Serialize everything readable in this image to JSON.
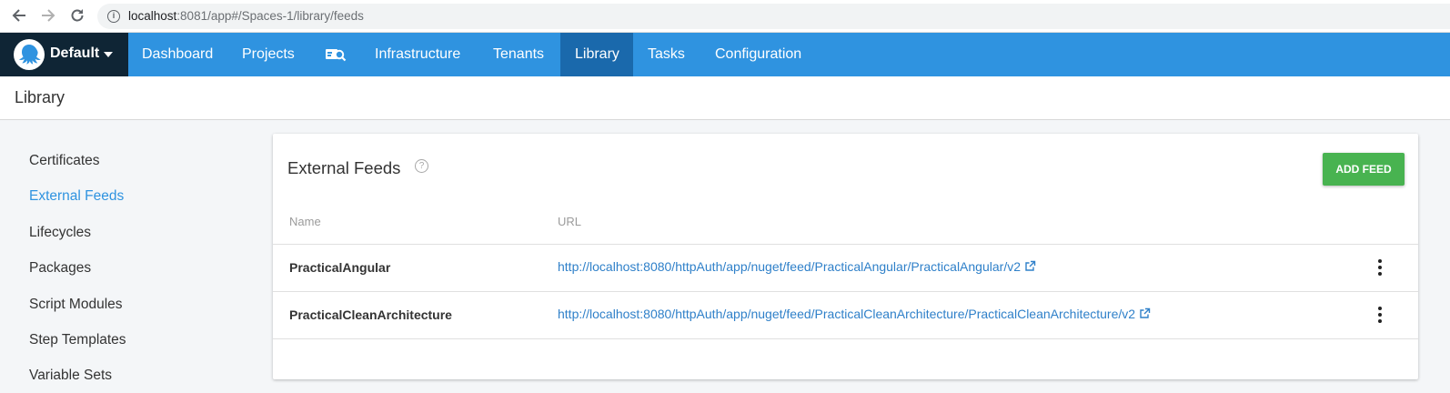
{
  "browser": {
    "url_host": "localhost",
    "url_rest": ":8081/app#/Spaces-1/library/feeds"
  },
  "topnav": {
    "space": "Default",
    "items": [
      "Dashboard",
      "Projects",
      "Infrastructure",
      "Tenants",
      "Library",
      "Tasks",
      "Configuration"
    ],
    "active": "Library"
  },
  "page": {
    "title": "Library"
  },
  "sidebar": {
    "items": [
      "Certificates",
      "External Feeds",
      "Lifecycles",
      "Packages",
      "Script Modules",
      "Step Templates",
      "Variable Sets"
    ],
    "active": "External Feeds"
  },
  "feeds": {
    "title": "External Feeds",
    "add_label": "ADD FEED",
    "columns": {
      "name": "Name",
      "url": "URL"
    },
    "rows": [
      {
        "name": "PracticalAngular",
        "url": "http://localhost:8080/httpAuth/app/nuget/feed/PracticalAngular/PracticalAngular/v2"
      },
      {
        "name": "PracticalCleanArchitecture",
        "url": "http://localhost:8080/httpAuth/app/nuget/feed/PracticalCleanArchitecture/PracticalCleanArchitecture/v2"
      }
    ]
  },
  "colors": {
    "nav_bg": "#2f93e0",
    "nav_active": "#1a69ac",
    "space_bg": "#0f2535",
    "link": "#2f80c9",
    "add_button": "#48b350"
  },
  "icons": [
    "back-arrow-icon",
    "forward-arrow-icon",
    "reload-icon",
    "info-icon",
    "octopus-logo-icon",
    "search-icon",
    "help-icon",
    "external-link-icon",
    "more-vert-icon"
  ]
}
